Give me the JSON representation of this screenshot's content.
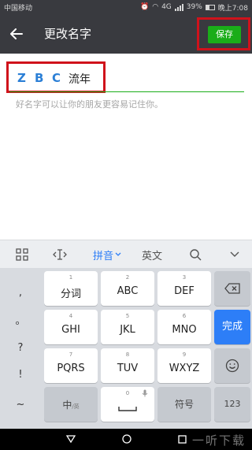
{
  "status_bar": {
    "carrier": "中国移动",
    "network": "4G",
    "battery": "39%",
    "time": "晚上7:08"
  },
  "nav": {
    "title": "更改名字",
    "save_label": "保存"
  },
  "content": {
    "name_value": "流年",
    "logo_letters": [
      "Z",
      "B",
      "C"
    ],
    "hint": "好名字可以让你的朋友更容易记住你。"
  },
  "keyboard_toolbar": {
    "pinyin": "拼音",
    "english": "英文"
  },
  "keyboard": {
    "symbols": [
      ",",
      "。",
      "?",
      "!",
      "~"
    ],
    "keys": [
      {
        "num": "1",
        "label": "分词"
      },
      {
        "num": "2",
        "label": "ABC"
      },
      {
        "num": "3",
        "label": "DEF"
      },
      {
        "num": "4",
        "label": "GHI"
      },
      {
        "num": "5",
        "label": "JKL"
      },
      {
        "num": "6",
        "label": "MNO"
      },
      {
        "num": "7",
        "label": "PQRS"
      },
      {
        "num": "8",
        "label": "TUV"
      },
      {
        "num": "9",
        "label": "WXYZ"
      }
    ],
    "zh_label": "中",
    "zh_sub": "/英",
    "zero": "0",
    "fuhao": "符号",
    "done": "完成",
    "num_switch": "123"
  },
  "watermark": "一听下载"
}
